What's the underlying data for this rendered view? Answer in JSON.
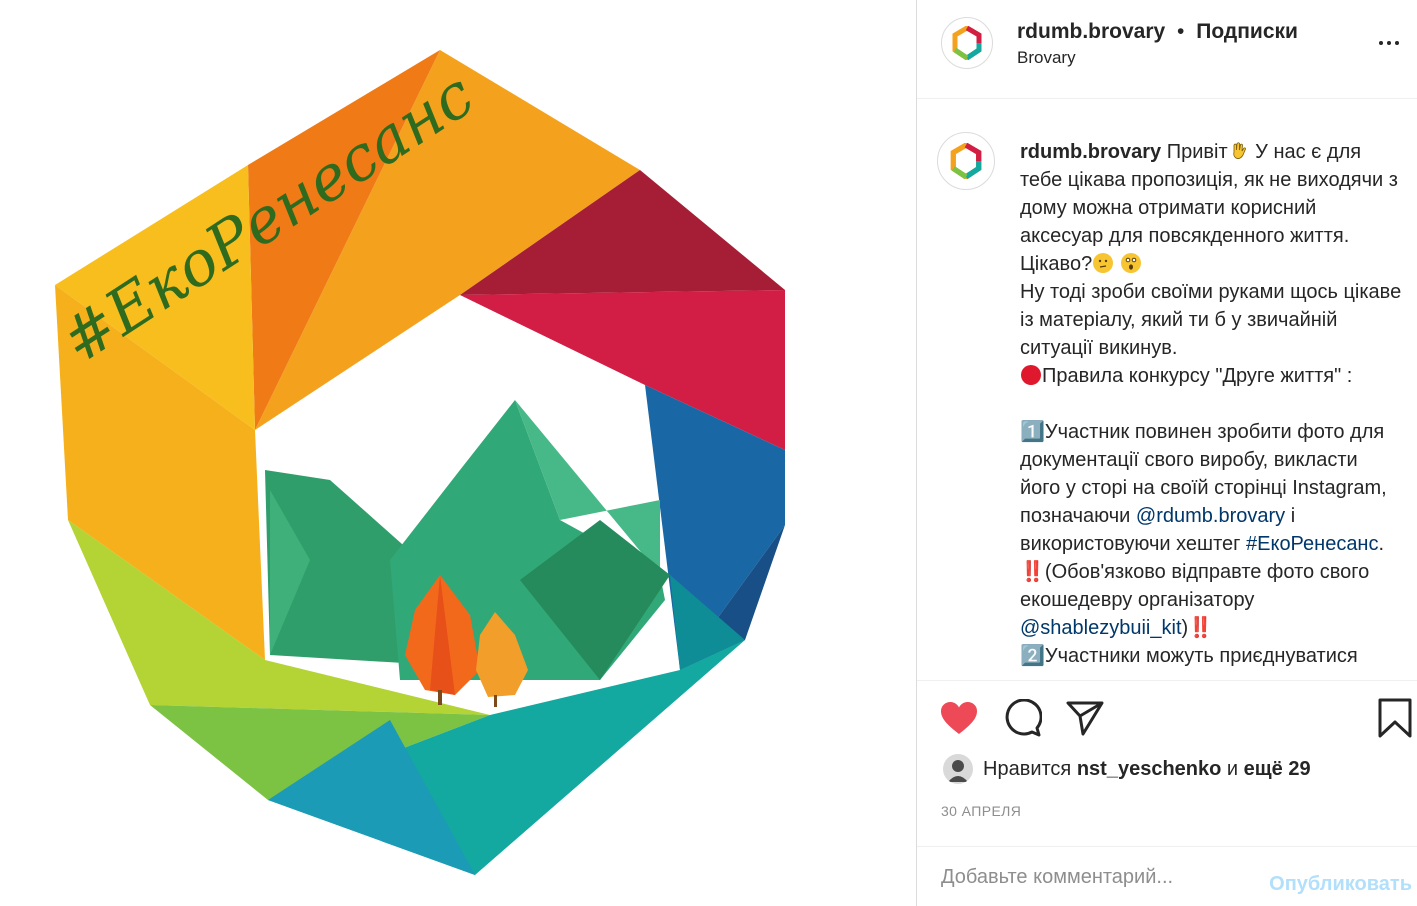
{
  "post": {
    "image_alt": "#ЕкоРенесанс logo",
    "image_text": "#ЕкоРенесанс"
  },
  "header": {
    "username": "rdumb.brovary",
    "separator": "•",
    "follow_label": "Подписки",
    "location": "Brovary",
    "more_icon": "more-options-icon"
  },
  "caption": {
    "username": "rdumb.brovary",
    "line1_text": " Привіт",
    "line1_after": " У нас є для тебе цікава пропозиція, як не виходячи з дому можна отримати корисний аксесуар для повсякденного життя. Цікаво?",
    "line2": "Ну тоді зроби своїми руками щось цікаве із матеріалу, який ти б у звичайній ситуації викинув.",
    "line3": "Правила конкурсу \"Друге життя\" :",
    "item1_num": "1️⃣",
    "item1_a": "Участник повинен зробити фото для документації свого виробу, викласти його у сторі на своїй сторінці Instagram, позначаючи ",
    "item1_mention": "@rdumb.brovary",
    "item1_b": " і використовуючи хештег ",
    "item1_hashtag": "#ЕкоРенесанс",
    "item1_c": ". ‼️(Обов'язково відправте фото свого екошедевру організатору ",
    "item1_mention2": "@shablezybuii_kit",
    "item1_d": ")‼️",
    "item2_num": "2️⃣",
    "item2_a": "Участники можуть приєднуватися"
  },
  "actions": {
    "like_icon": "heart-filled-icon",
    "comment_icon": "comment-icon",
    "share_icon": "share-icon",
    "save_icon": "bookmark-icon",
    "like_color": "#ed4956"
  },
  "likes": {
    "prefix": "Нравится",
    "user": "nst_yeschenko",
    "conj": "и",
    "more": "ещё 29"
  },
  "date": "30 АПРЕЛЯ",
  "comment": {
    "placeholder": "Добавьте комментарий...",
    "publish_label": "Опубликовать"
  }
}
